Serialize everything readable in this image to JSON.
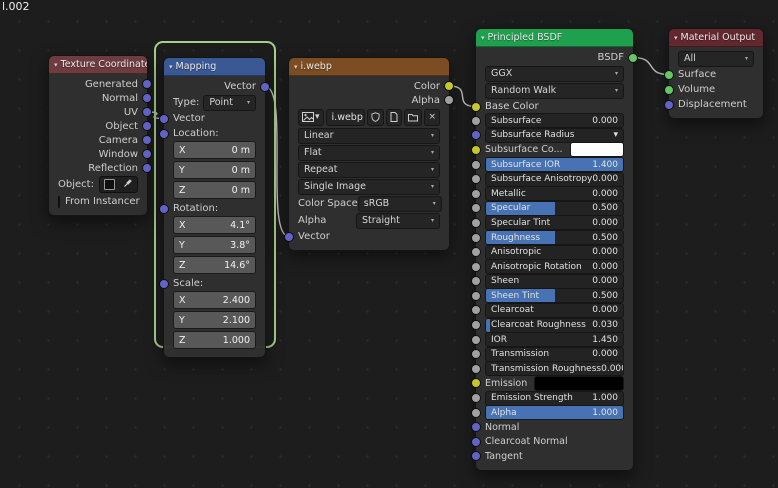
{
  "editor_label": "l.002",
  "colors": {
    "background": "#1d1d1d",
    "accent_slider_blue": "#4772b3",
    "socket_vector": "#6363c7",
    "socket_color": "#c7c729",
    "socket_value": "#a1a1a1",
    "socket_shader": "#63c763",
    "header_texture_coordinate": "#6e3b41",
    "header_mapping": "#3a5894",
    "header_image_texture": "#7c4d22",
    "header_principled": "#1fa04e",
    "header_material_output": "#63282e",
    "selection_outline": "#a9cf8d"
  },
  "texture_coordinate": {
    "title": "Texture Coordinate",
    "outputs": [
      "Generated",
      "Normal",
      "UV",
      "Object",
      "Camera",
      "Window",
      "Reflection"
    ],
    "object_label": "Object:",
    "from_instancer": "From Instancer"
  },
  "mapping": {
    "title": "Mapping",
    "output": "Vector",
    "type_label": "Type:",
    "type_value": "Point",
    "input": "Vector",
    "axes": {
      "x": "X",
      "y": "Y",
      "z": "Z"
    },
    "location": {
      "label": "Location:",
      "x": "0 m",
      "y": "0 m",
      "z": "0 m"
    },
    "rotation": {
      "label": "Rotation:",
      "x": "4.1°",
      "y": "3.8°",
      "z": "14.6°"
    },
    "scale": {
      "label": "Scale:",
      "x": "2.400",
      "y": "2.100",
      "z": "1.000"
    }
  },
  "image_texture": {
    "title": "i.webp",
    "outputs": {
      "color": "Color",
      "alpha": "Alpha"
    },
    "image_name": "i.webp",
    "interpolation": "Linear",
    "projection": "Flat",
    "extension": "Repeat",
    "source": "Single Image",
    "color_space_label": "Color Space",
    "color_space_value": "sRGB",
    "alpha_label": "Alpha",
    "alpha_value": "Straight",
    "input": "Vector"
  },
  "principled": {
    "title": "Principled BSDF",
    "output": "BSDF",
    "distribution": "GGX",
    "subsurface_method": "Random Walk",
    "base_color_label": "Base Color",
    "params": [
      {
        "label": "Subsurface",
        "value": "0.000",
        "fill": 0
      },
      {
        "label": "Subsurface Radius"
      },
      {
        "label": "Subsurface Co...",
        "swatch": "#ffffff"
      },
      {
        "label": "Subsurface IOR",
        "value": "1.400",
        "fill": 1
      },
      {
        "label": "Subsurface Anisotropy",
        "value": "0.000",
        "fill": 0
      },
      {
        "label": "Metallic",
        "value": "0.000",
        "fill": 0
      },
      {
        "label": "Specular",
        "value": "0.500",
        "fill": 0.5
      },
      {
        "label": "Specular Tint",
        "value": "0.000",
        "fill": 0
      },
      {
        "label": "Roughness",
        "value": "0.500",
        "fill": 0.5
      },
      {
        "label": "Anisotropic",
        "value": "0.000",
        "fill": 0
      },
      {
        "label": "Anisotropic Rotation",
        "value": "0.000",
        "fill": 0
      },
      {
        "label": "Sheen",
        "value": "0.000",
        "fill": 0
      },
      {
        "label": "Sheen Tint",
        "value": "0.500",
        "fill": 0.5
      },
      {
        "label": "Clearcoat",
        "value": "0.000",
        "fill": 0
      },
      {
        "label": "Clearcoat Roughness",
        "value": "0.030",
        "fill": 0.03
      },
      {
        "label": "IOR",
        "value": "1.450",
        "fill": 0
      },
      {
        "label": "Transmission",
        "value": "0.000",
        "fill": 0
      },
      {
        "label": "Transmission Roughness",
        "value": "0.000",
        "fill": 0
      },
      {
        "label": "Emission",
        "swatch": "#000000"
      },
      {
        "label": "Emission Strength",
        "value": "1.000",
        "fill": 0
      },
      {
        "label": "Alpha",
        "value": "1.000",
        "fill": 1
      },
      {
        "label": "Normal"
      },
      {
        "label": "Clearcoat Normal"
      },
      {
        "label": "Tangent"
      }
    ]
  },
  "material_output": {
    "title": "Material Output",
    "target": "All",
    "inputs": [
      "Surface",
      "Volume",
      "Displacement"
    ]
  },
  "links": [
    {
      "from": "s-tc-uv",
      "to": "s-map-vec-in"
    },
    {
      "from": "s-map-vec-out",
      "to": "s-img-vec-in"
    },
    {
      "from": "s-img-color",
      "to": "s-pr-basecolor"
    },
    {
      "from": "s-pr-bsdf",
      "to": "s-out-surface"
    }
  ]
}
